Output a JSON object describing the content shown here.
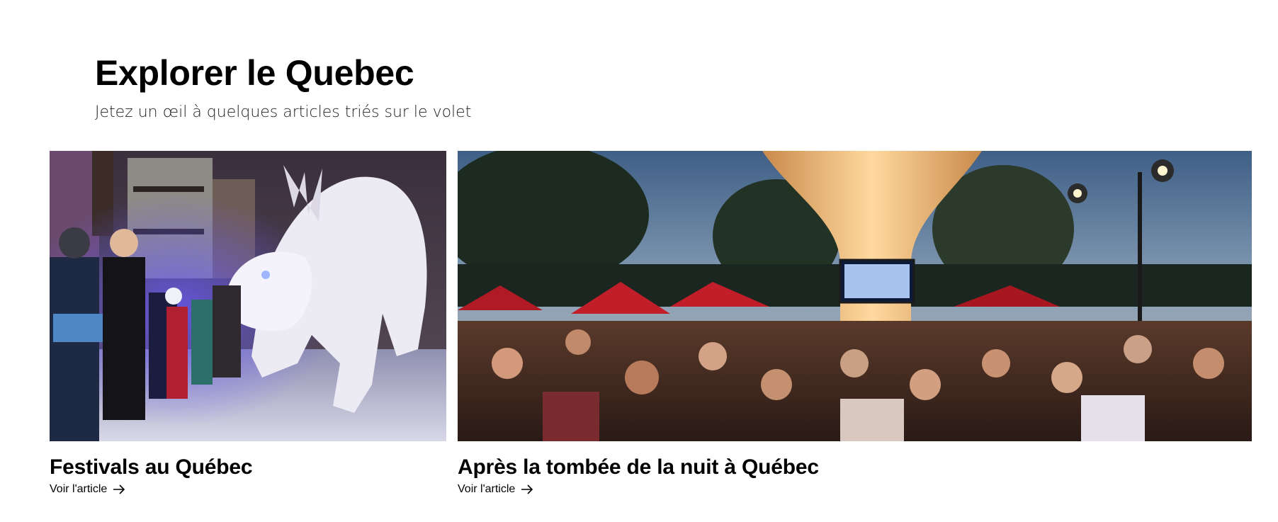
{
  "section": {
    "title": "Explorer le Quebec",
    "subtitle": "Jetez un œil à quelques articles triés sur le volet"
  },
  "cards": [
    {
      "title": "Festivals au Québec",
      "link_label": "Voir l'article",
      "image_subject": "lantern-lion-festival-night-photo"
    },
    {
      "title": "Après la tombée de la nuit à Québec",
      "link_label": "Voir l'article",
      "image_subject": "outdoor-night-crowd-terrace-photo"
    }
  ],
  "icons": {
    "link_arrow": "arrow-right-icon"
  },
  "colors": {
    "text": "#000000",
    "background": "#ffffff"
  }
}
